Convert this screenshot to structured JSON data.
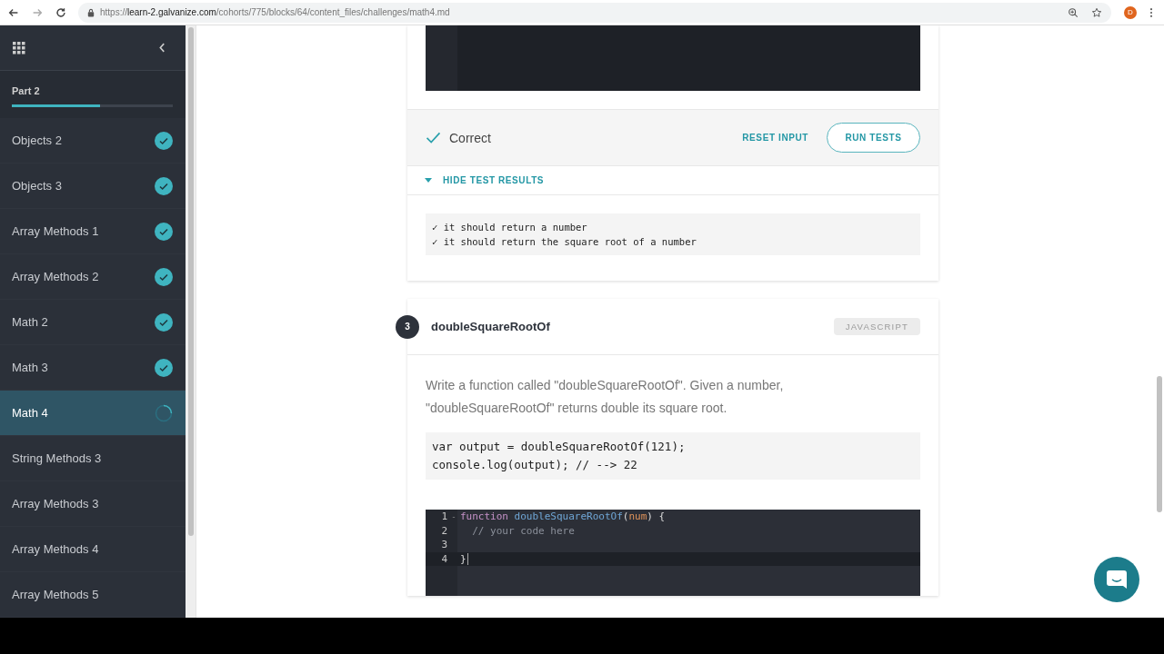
{
  "browser": {
    "url_scheme": "https://",
    "url_host": "learn-2.galvanize.com",
    "url_path": "/cohorts/775/blocks/64/content_files/challenges/math4.md",
    "avatar": "D"
  },
  "sidebar": {
    "section": "Part 2",
    "level": 0.55,
    "items": [
      {
        "label": "Objects 2",
        "completed": true,
        "in_progress": false,
        "selected": false
      },
      {
        "label": "Objects 3",
        "completed": true,
        "in_progress": false,
        "selected": false
      },
      {
        "label": "Array Methods 1",
        "completed": true,
        "in_progress": false,
        "selected": false
      },
      {
        "label": "Array Methods 2",
        "completed": true,
        "in_progress": false,
        "selected": false
      },
      {
        "label": "Math 2",
        "completed": true,
        "in_progress": false,
        "selected": false
      },
      {
        "label": "Math 3",
        "completed": true,
        "in_progress": false,
        "selected": false
      },
      {
        "label": "Math 4",
        "completed": false,
        "in_progress": true,
        "selected": true
      },
      {
        "label": "String Methods 3",
        "completed": false,
        "in_progress": false,
        "selected": false
      },
      {
        "label": "Array Methods 3",
        "completed": false,
        "in_progress": false,
        "selected": false
      },
      {
        "label": "Array Methods 4",
        "completed": false,
        "in_progress": false,
        "selected": false
      },
      {
        "label": "Array Methods 5",
        "completed": false,
        "in_progress": false,
        "selected": false
      }
    ]
  },
  "previous_challenge": {
    "result": "Correct",
    "reset_button": "RESET INPUT",
    "run_button": "RUN TESTS",
    "toggle": "HIDE TEST RESULTS",
    "expanded": true,
    "test_results": [
      "✓ it should return a number",
      "✓ it should return the square root of a number"
    ]
  },
  "challenge": {
    "number": "3",
    "title": "doubleSquareRootOf",
    "language": "JAVASCRIPT",
    "description": "Write a function called \"doubleSquareRootOf\". Given a number, \"doubleSquareRootOf\" returns double its square root.",
    "example": [
      "var output = doubleSquareRootOf(121);",
      "console.log(output); // --> 22"
    ],
    "editor_lines": [
      {
        "number": "1",
        "fold": "-",
        "active": false,
        "tokens": [
          {
            "kind": "keyword",
            "text": "function "
          },
          {
            "kind": "function",
            "text": "doubleSquareRootOf"
          },
          {
            "kind": "plain",
            "text": "("
          },
          {
            "kind": "param",
            "text": "num"
          },
          {
            "kind": "plain",
            "text": ") {"
          }
        ]
      },
      {
        "number": "2",
        "active": false,
        "tokens": [
          {
            "kind": "comment",
            "text": "  // your code here"
          }
        ]
      },
      {
        "number": "3",
        "active": false
      },
      {
        "number": "4",
        "active": true,
        "tokens": [
          {
            "kind": "plain",
            "text": "}"
          }
        ]
      }
    ]
  }
}
